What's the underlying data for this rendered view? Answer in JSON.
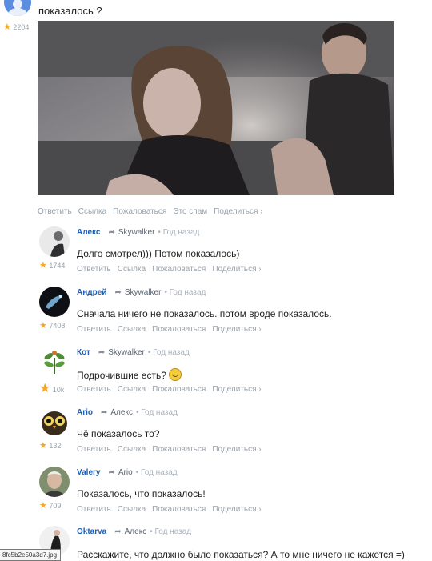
{
  "post": {
    "question": "показалось ?",
    "author_rating": "2204",
    "actions": [
      "Ответить",
      "Ссылка",
      "Пожаловаться",
      "Это спам",
      "Поделиться ›"
    ]
  },
  "comments": [
    {
      "author": "Алекс",
      "reply_to": "Skywalker",
      "time": "• Год назад",
      "text": "Долго смотрел))) Потом показалось)",
      "rating": "1744",
      "actions": [
        "Ответить",
        "Ссылка",
        "Пожаловаться",
        "Поделиться ›"
      ]
    },
    {
      "author": "Андрей",
      "reply_to": "Skywalker",
      "time": "• Год назад",
      "text": "Сначала ничего не показалось. потом вроде показалось.",
      "rating": "7408",
      "actions": [
        "Ответить",
        "Ссылка",
        "Пожаловаться",
        "Поделиться ›"
      ]
    },
    {
      "author": "Кот",
      "reply_to": "Skywalker",
      "time": "• Год назад",
      "text": "Подрочившие есть?",
      "rating": "10k",
      "actions": [
        "Ответить",
        "Ссылка",
        "Пожаловаться",
        "Поделиться ›"
      ]
    },
    {
      "author": "Ario",
      "reply_to": "Алекс",
      "time": "• Год назад",
      "text": "Чё показалось то?",
      "rating": "132",
      "actions": [
        "Ответить",
        "Ссылка",
        "Пожаловаться",
        "Поделиться ›"
      ]
    },
    {
      "author": "Valery",
      "reply_to": "Ario",
      "time": "• Год назад",
      "text": "Показалось, что показалось!",
      "rating": "709",
      "actions": [
        "Ответить",
        "Ссылка",
        "Пожаловаться",
        "Поделиться ›"
      ]
    },
    {
      "author": "Oktarva",
      "reply_to": "Алекс",
      "time": "• Год назад",
      "text": "Расскажите, что должно было показаться? А то мне ничего не кажется =)",
      "rating": "",
      "actions": []
    }
  ],
  "tooltip": "8fc5b2e50a3d7.jpg",
  "icons": {
    "reply": "reply-arrow-icon",
    "rating": "star-icon",
    "emoji": "smiley-icon"
  },
  "colors": {
    "author_link": "#1d5fb4",
    "muted": "#9aa3ad",
    "star": "#f5a623"
  }
}
